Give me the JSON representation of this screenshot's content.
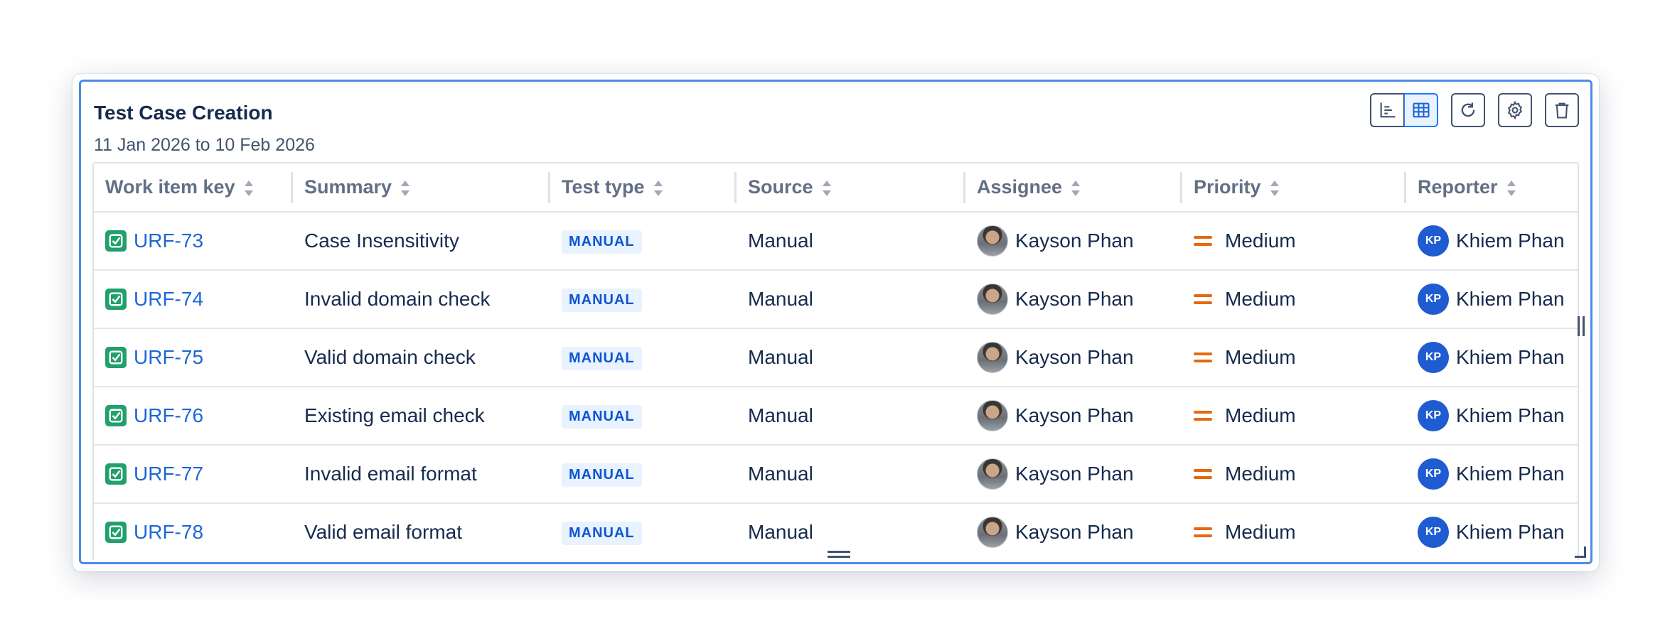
{
  "gadget": {
    "title": "Test Case Creation",
    "date_range": "11 Jan 2026 to 10 Feb 2026"
  },
  "toolbar": {
    "icons": [
      "chart-view-icon",
      "table-view-icon",
      "refresh-icon",
      "settings-icon",
      "delete-icon"
    ],
    "active_view": "table"
  },
  "table": {
    "columns": [
      "Work item key",
      "Summary",
      "Test type",
      "Source",
      "Assignee",
      "Priority",
      "Reporter"
    ],
    "rows": [
      {
        "key": "URF-73",
        "summary": "Case Insensitivity",
        "test_type": "MANUAL",
        "source": "Manual",
        "assignee": "Kayson Phan",
        "priority": "Medium",
        "reporter": "Khiem Phan",
        "reporter_initials": "KP"
      },
      {
        "key": "URF-74",
        "summary": "Invalid domain check",
        "test_type": "MANUAL",
        "source": "Manual",
        "assignee": "Kayson Phan",
        "priority": "Medium",
        "reporter": "Khiem Phan",
        "reporter_initials": "KP"
      },
      {
        "key": "URF-75",
        "summary": "Valid domain check",
        "test_type": "MANUAL",
        "source": "Manual",
        "assignee": "Kayson Phan",
        "priority": "Medium",
        "reporter": "Khiem Phan",
        "reporter_initials": "KP"
      },
      {
        "key": "URF-76",
        "summary": "Existing email check",
        "test_type": "MANUAL",
        "source": "Manual",
        "assignee": "Kayson Phan",
        "priority": "Medium",
        "reporter": "Khiem Phan",
        "reporter_initials": "KP"
      },
      {
        "key": "URF-77",
        "summary": "Invalid email format",
        "test_type": "MANUAL",
        "source": "Manual",
        "assignee": "Kayson Phan",
        "priority": "Medium",
        "reporter": "Khiem Phan",
        "reporter_initials": "KP"
      },
      {
        "key": "URF-78",
        "summary": "Valid email format",
        "test_type": "MANUAL",
        "source": "Manual",
        "assignee": "Kayson Phan",
        "priority": "Medium",
        "reporter": "Khiem Phan",
        "reporter_initials": "KP"
      }
    ]
  },
  "colors": {
    "accent": "#1d66d6",
    "focus_border": "#4c8ce8",
    "test_icon": "#22a06b",
    "priority_medium": "#e56910",
    "reporter_avatar": "#1f5bd1"
  }
}
